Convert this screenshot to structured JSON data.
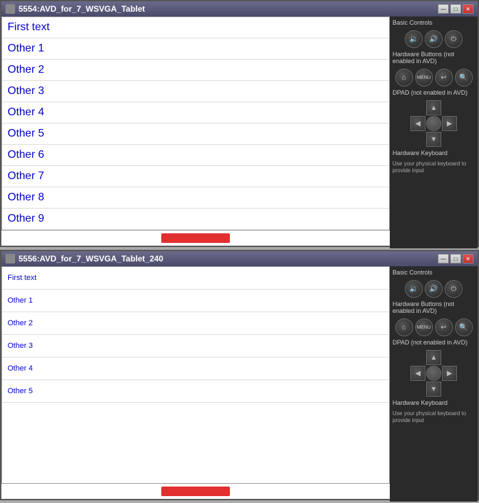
{
  "window1": {
    "title": "5554:AVD_for_7_WSVGA_Tablet",
    "items": [
      "First text",
      "Other 1",
      "Other 2",
      "Other 3",
      "Other 4",
      "Other 5",
      "Other 6",
      "Other 7",
      "Other 8",
      "Other 9"
    ],
    "controls": {
      "basic_label": "Basic Controls",
      "hw_buttons_label": "Hardware Buttons (not enabled in AVD)",
      "dpad_label": "DPAD (not enabled in AVD)",
      "keyboard_label": "Hardware Keyboard",
      "keyboard_text": "Use your physical keyboard to provide input"
    }
  },
  "window2": {
    "title": "5556:AVD_for_7_WSVGA_Tablet_240",
    "items": [
      "First text",
      "Other 1",
      "Other 2",
      "Other 3",
      "Other 4",
      "Other 5"
    ],
    "controls": {
      "basic_label": "Basic Controls",
      "hw_buttons_label": "Hardware Buttons (not enabled in AVD)",
      "dpad_label": "DPAD (not enabled in AVD)",
      "keyboard_label": "Hardware Keyboard",
      "keyboard_text": "Use your physical keyboard to provide input"
    }
  },
  "tb_buttons": {
    "minimize": "—",
    "maximize": "□",
    "close": "✕"
  }
}
